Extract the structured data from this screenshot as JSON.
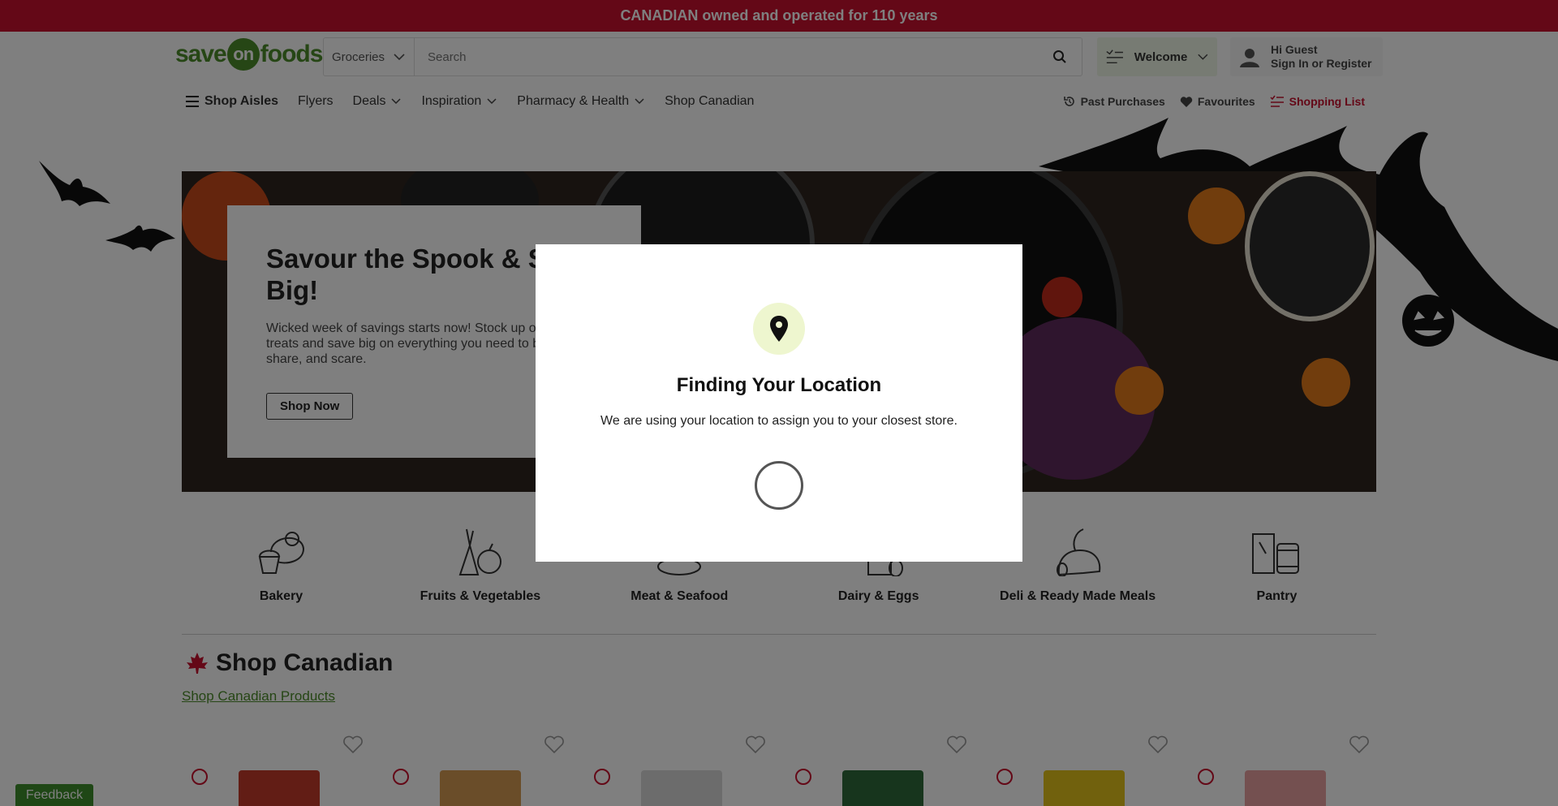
{
  "promo": {
    "text": "CANADIAN owned and operated for 110 years"
  },
  "header": {
    "logo": {
      "part1": "save",
      "part2": "on",
      "part3": "foods"
    },
    "search": {
      "category": "Groceries",
      "placeholder": "Search"
    },
    "welcome": "Welcome",
    "account": {
      "line1": "Hi Guest",
      "line2": "Sign In or Register"
    }
  },
  "nav": {
    "left": [
      {
        "label": "Shop Aisles"
      },
      {
        "label": "Flyers"
      },
      {
        "label": "Deals"
      },
      {
        "label": "Inspiration"
      },
      {
        "label": "Pharmacy & Health"
      },
      {
        "label": "Shop Canadian"
      }
    ],
    "right": [
      {
        "label": "Past Purchases"
      },
      {
        "label": "Favourites"
      },
      {
        "label": "Shopping List"
      }
    ]
  },
  "hero": {
    "title": "Savour the Spook & S\nBig!",
    "description": "Wicked week of savings starts now! Stock up o treats and save big on everything you need to b share, and scare.",
    "button": "Shop Now"
  },
  "categories": [
    {
      "label": "Bakery",
      "icon": "bakery-icon"
    },
    {
      "label": "Fruits & Vegetables",
      "icon": "produce-icon"
    },
    {
      "label": "Meat & Seafood",
      "icon": "meat-icon"
    },
    {
      "label": "Dairy & Eggs",
      "icon": "dairy-icon"
    },
    {
      "label": "Deli & Ready Made Meals",
      "icon": "deli-icon"
    },
    {
      "label": "Pantry",
      "icon": "pantry-icon"
    }
  ],
  "shop_canadian": {
    "title": "Shop Canadian",
    "link": "Shop Canadian Products"
  },
  "feedback": "Feedback",
  "modal": {
    "title": "Finding Your Location",
    "text": "We are using your location to assign you to your closest store."
  },
  "colors": {
    "brand_red": "#c8102e",
    "brand_green": "#4c8c2b",
    "pin_bg": "#eef6cf"
  }
}
